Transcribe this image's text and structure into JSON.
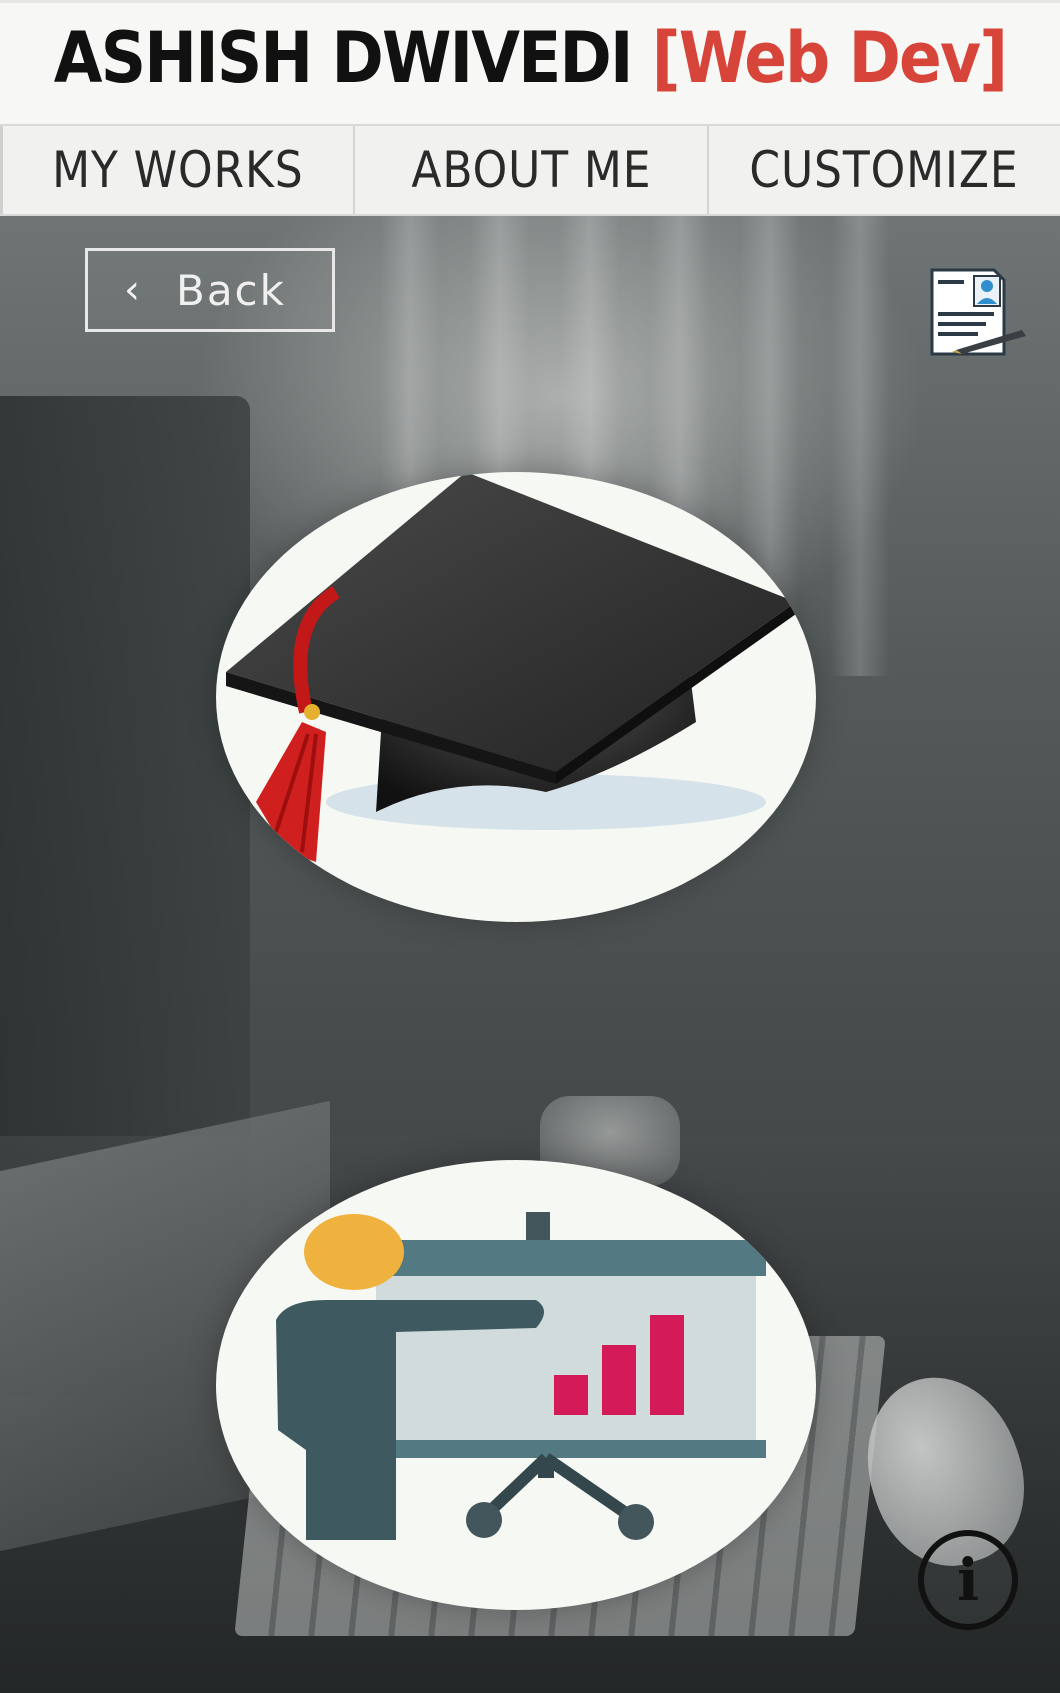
{
  "header": {
    "name": "ASHISH DWIVEDI",
    "role": "[Web Dev]",
    "accent_color": "#d7443a"
  },
  "nav": {
    "items": [
      {
        "label": "MY WORKS"
      },
      {
        "label": "ABOUT ME"
      },
      {
        "label": "CUSTOMIZE"
      }
    ]
  },
  "toolbar": {
    "back_label": "Back",
    "back_icon": "chevron-left-icon",
    "resume_icon": "resume-document-icon",
    "info_icon": "info-icon",
    "info_glyph": "i"
  },
  "tiles": [
    {
      "icon": "graduation-cap-icon"
    },
    {
      "icon": "presentation-chart-icon"
    }
  ]
}
